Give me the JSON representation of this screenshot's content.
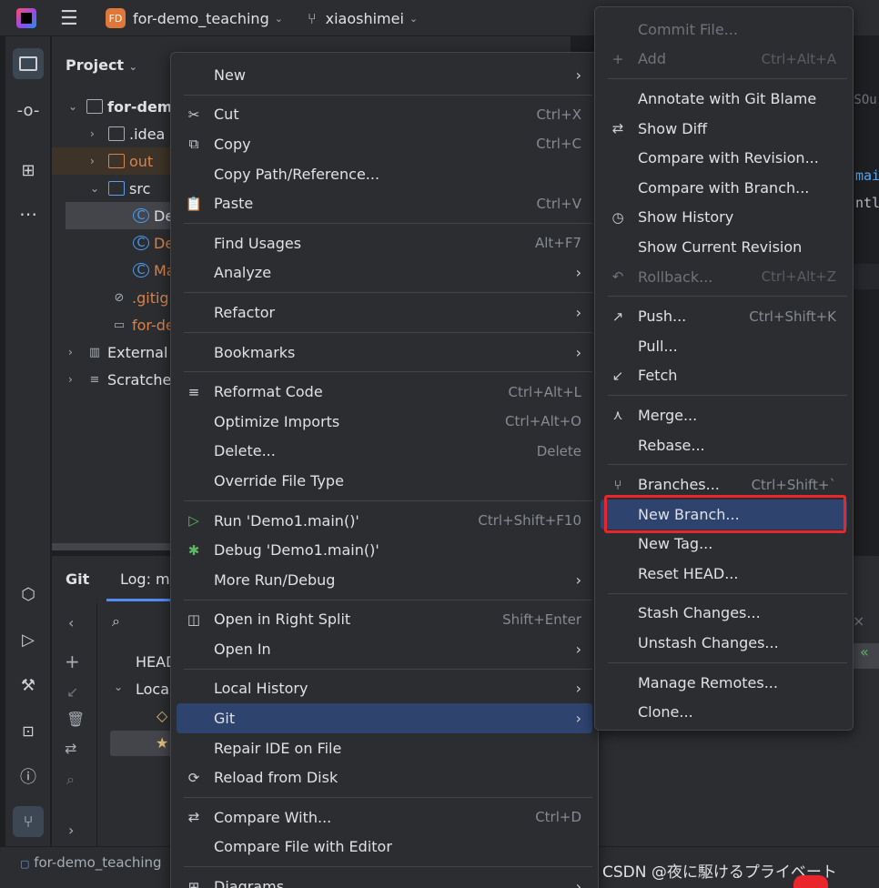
{
  "titlebar": {
    "project_badge": "FD",
    "project_name": "for-demo_teaching",
    "branch": "xiaoshimei"
  },
  "project_panel": {
    "title": "Project",
    "tree": [
      {
        "label": "for-dem",
        "indent": 0,
        "kind": "root"
      },
      {
        "label": ".idea",
        "indent": 1,
        "kind": "folder"
      },
      {
        "label": "out",
        "indent": 1,
        "kind": "folder-orange"
      },
      {
        "label": "src",
        "indent": 1,
        "kind": "folder-blue"
      },
      {
        "label": "De",
        "indent": 2,
        "kind": "class"
      },
      {
        "label": "De",
        "indent": 2,
        "kind": "class"
      },
      {
        "label": "Ma",
        "indent": 2,
        "kind": "class"
      },
      {
        "label": ".gitigr",
        "indent": 1,
        "kind": "ignore"
      },
      {
        "label": "for-de",
        "indent": 1,
        "kind": "file"
      },
      {
        "label": "External",
        "indent": 0,
        "kind": "lib"
      },
      {
        "label": "Scratche",
        "indent": 0,
        "kind": "scratch"
      }
    ]
  },
  "git_panel": {
    "tab_git": "Git",
    "tab_log": "Log: ma",
    "head_label": "HEAD",
    "local_label": "Loca"
  },
  "editor_fragments": [
    "LSOu",
    "mai",
    "ntln"
  ],
  "statusbar": {
    "breadcrumb": "for-demo_teaching"
  },
  "context_menu": {
    "items": [
      {
        "label": "New",
        "submenu": true
      },
      {
        "sep": true
      },
      {
        "label": "Cut",
        "shortcut": "Ctrl+X",
        "icon": "✂"
      },
      {
        "label": "Copy",
        "shortcut": "Ctrl+C",
        "icon": "⧉"
      },
      {
        "label": "Copy Path/Reference..."
      },
      {
        "label": "Paste",
        "shortcut": "Ctrl+V",
        "icon": "📋"
      },
      {
        "sep": true
      },
      {
        "label": "Find Usages",
        "shortcut": "Alt+F7"
      },
      {
        "label": "Analyze",
        "submenu": true
      },
      {
        "sep": true
      },
      {
        "label": "Refactor",
        "submenu": true
      },
      {
        "sep": true
      },
      {
        "label": "Bookmarks",
        "submenu": true
      },
      {
        "sep": true
      },
      {
        "label": "Reformat Code",
        "shortcut": "Ctrl+Alt+L",
        "icon": "≡"
      },
      {
        "label": "Optimize Imports",
        "shortcut": "Ctrl+Alt+O"
      },
      {
        "label": "Delete...",
        "shortcut": "Delete"
      },
      {
        "label": "Override File Type"
      },
      {
        "sep": true
      },
      {
        "label": "Run 'Demo1.main()'",
        "shortcut": "Ctrl+Shift+F10",
        "icon": "▷"
      },
      {
        "label": "Debug 'Demo1.main()'",
        "icon": "✱"
      },
      {
        "label": "More Run/Debug",
        "submenu": true
      },
      {
        "sep": true
      },
      {
        "label": "Open in Right Split",
        "shortcut": "Shift+Enter",
        "icon": "◫"
      },
      {
        "label": "Open In",
        "submenu": true
      },
      {
        "sep": true
      },
      {
        "label": "Local History",
        "submenu": true
      },
      {
        "label": "Git",
        "submenu": true,
        "highlight": true
      },
      {
        "label": "Repair IDE on File"
      },
      {
        "label": "Reload from Disk",
        "icon": "⟳"
      },
      {
        "sep": true
      },
      {
        "label": "Compare With...",
        "shortcut": "Ctrl+D",
        "icon": "⇄"
      },
      {
        "label": "Compare File with Editor"
      },
      {
        "sep": true
      },
      {
        "label": "Diagrams",
        "submenu": true,
        "icon": "⊞"
      }
    ]
  },
  "git_menu": {
    "items": [
      {
        "label": "Commit File...",
        "disabled": true
      },
      {
        "label": "Add",
        "shortcut": "Ctrl+Alt+A",
        "disabled": true,
        "icon": "+"
      },
      {
        "sep": true
      },
      {
        "label": "Annotate with Git Blame"
      },
      {
        "label": "Show Diff",
        "icon": "⇄"
      },
      {
        "label": "Compare with Revision..."
      },
      {
        "label": "Compare with Branch..."
      },
      {
        "label": "Show History",
        "icon": "◷"
      },
      {
        "label": "Show Current Revision"
      },
      {
        "label": "Rollback...",
        "shortcut": "Ctrl+Alt+Z",
        "disabled": true,
        "icon": "↶"
      },
      {
        "sep": true
      },
      {
        "label": "Push...",
        "shortcut": "Ctrl+Shift+K",
        "icon": "↗"
      },
      {
        "label": "Pull..."
      },
      {
        "label": "Fetch",
        "icon": "↙"
      },
      {
        "sep": true
      },
      {
        "label": "Merge...",
        "icon": "⋏"
      },
      {
        "label": "Rebase..."
      },
      {
        "sep": true
      },
      {
        "label": "Branches...",
        "shortcut": "Ctrl+Shift+`",
        "icon": "⑂"
      },
      {
        "label": "New Branch...",
        "highlight": true
      },
      {
        "label": "New Tag..."
      },
      {
        "label": "Reset HEAD..."
      },
      {
        "sep": true
      },
      {
        "label": "Stash Changes..."
      },
      {
        "label": "Unstash Changes..."
      },
      {
        "sep": true
      },
      {
        "label": "Manage Remotes..."
      },
      {
        "label": "Clone..."
      }
    ]
  },
  "watermark": "CSDN @夜に駆けるプライベート",
  "colors": {
    "menu_bg": "#2b2d30",
    "highlight": "#2e436e",
    "annotation_box": "#e8262b",
    "project_badge": "#e0773a"
  }
}
